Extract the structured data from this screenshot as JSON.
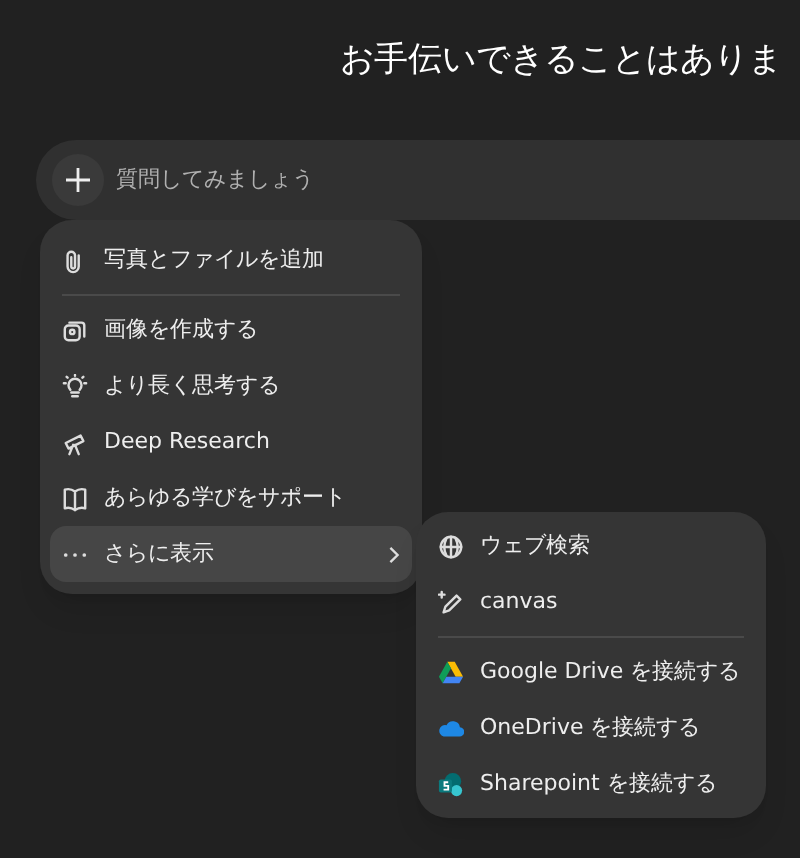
{
  "heading": "お手伝いできることはありま",
  "composer": {
    "placeholder": "質問してみましょう"
  },
  "menu": [
    {
      "kind": "attach",
      "label": "写真とファイルを追加",
      "selected": false
    },
    {
      "kind": "image",
      "label": "画像を作成する",
      "selected": false
    },
    {
      "kind": "think",
      "label": "より長く思考する",
      "selected": false
    },
    {
      "kind": "research",
      "label": "Deep Research",
      "selected": false
    },
    {
      "kind": "study",
      "label": "あらゆる学びをサポート",
      "selected": false
    },
    {
      "kind": "more",
      "label": "さらに表示",
      "selected": true
    }
  ],
  "submenu": [
    {
      "kind": "web",
      "label": "ウェブ検索"
    },
    {
      "kind": "canvas",
      "label": "canvas"
    },
    {
      "kind": "gdrive",
      "label": "Google Drive を接続する"
    },
    {
      "kind": "onedrive",
      "label": "OneDrive を接続する"
    },
    {
      "kind": "sharepoint",
      "label": "Sharepoint を接続する"
    }
  ]
}
